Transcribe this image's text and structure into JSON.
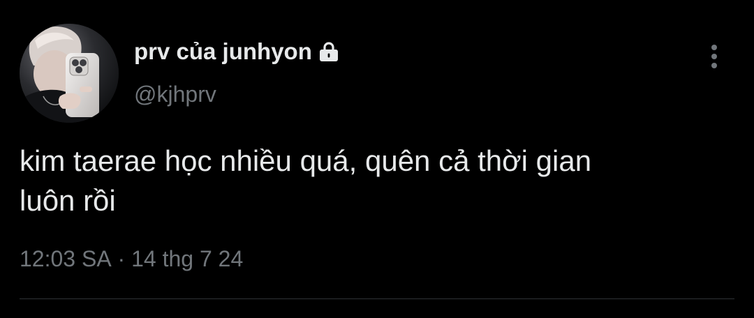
{
  "tweet": {
    "display_name": "prv của junhyon",
    "handle": "@kjhprv",
    "protected_icon": "lock-icon",
    "more_icon": "more-vertical-icon",
    "text": "kim taerae học nhiều quá, quên cả thời gian\nluôn rồi",
    "time": "12:03 SA",
    "separator": " · ",
    "date": "14 thg 7 24"
  },
  "colors": {
    "background": "#000000",
    "primary_text": "#e7e9ea",
    "secondary_text": "#71767b",
    "divider": "#2f3336"
  }
}
